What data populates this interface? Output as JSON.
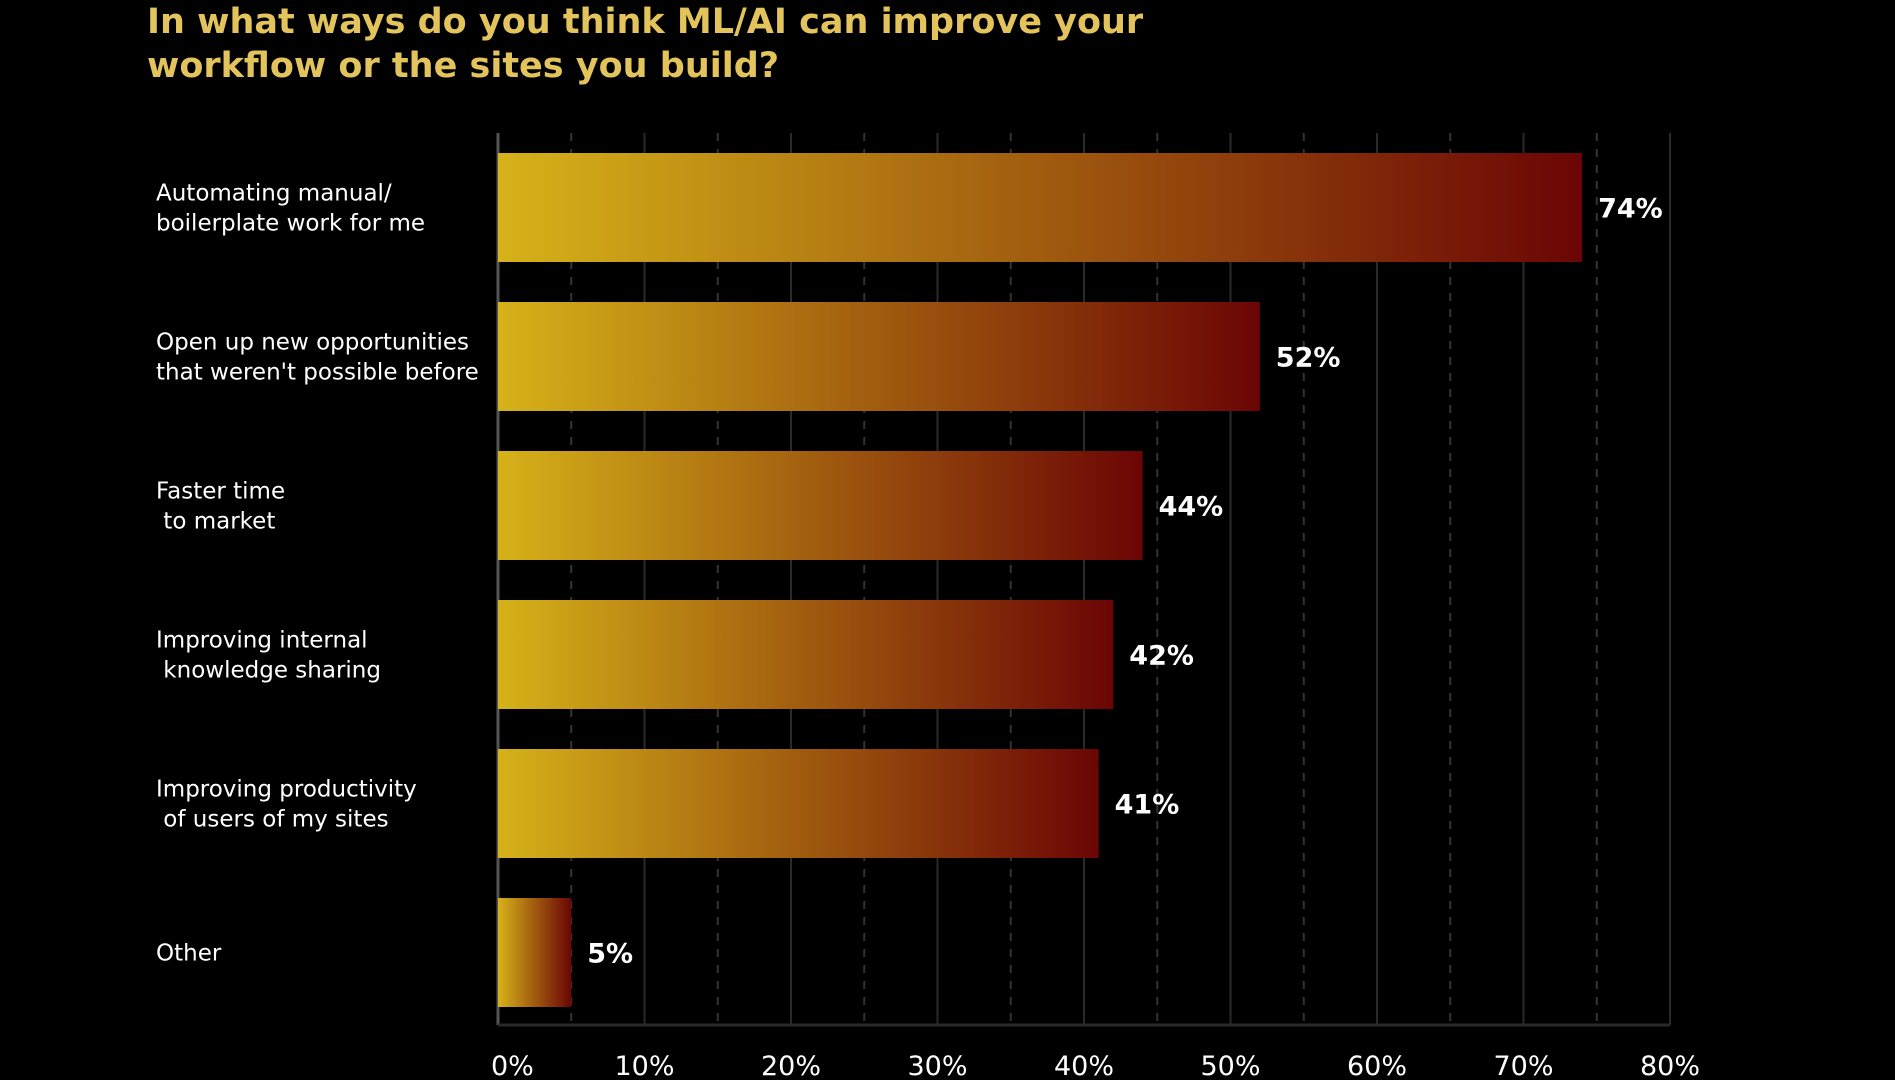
{
  "chart_data": {
    "type": "bar",
    "orientation": "horizontal",
    "title": "In what ways do you think ML/AI can improve your\nworkflow or the sites you build?",
    "categories": [
      [
        "Automating manual/",
        "boilerplate work for me"
      ],
      [
        "Open up new opportunities",
        "that weren't possible before"
      ],
      [
        "Faster time",
        " to market"
      ],
      [
        "Improving internal",
        " knowledge sharing"
      ],
      [
        "Improving productivity",
        " of users of my sites"
      ],
      [
        "Other"
      ]
    ],
    "values": [
      74,
      52,
      44,
      42,
      41,
      5
    ],
    "value_labels": [
      "74%",
      "52%",
      "44%",
      "42%",
      "41%",
      "5%"
    ],
    "xlim": [
      0,
      80
    ],
    "xticks": [
      0,
      10,
      20,
      30,
      40,
      50,
      60,
      70,
      80
    ],
    "xtick_labels": [
      "0%",
      "10%",
      "20%",
      "30%",
      "40%",
      "50%",
      "60%",
      "70%",
      "80%"
    ],
    "grid": true,
    "colors": {
      "title": "#e3c45c",
      "bar_start": "#d6b219",
      "bar_end": "#6b0505",
      "background": "#000000"
    }
  }
}
